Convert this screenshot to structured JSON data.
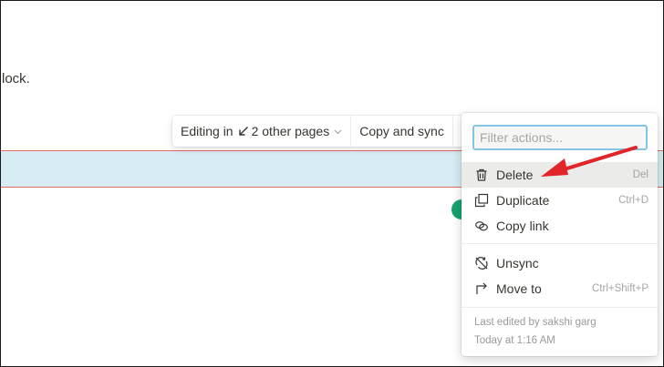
{
  "page": {
    "body_text": "lock."
  },
  "toolbar": {
    "editing_prefix": "Editing in",
    "editing_suffix": "2 other pages",
    "copy_and_sync": "Copy and sync"
  },
  "menu": {
    "filter_placeholder": "Filter actions...",
    "items": [
      {
        "label": "Delete",
        "shortcut": "Del",
        "icon": "trash-icon"
      },
      {
        "label": "Duplicate",
        "shortcut": "Ctrl+D",
        "icon": "duplicate-icon"
      },
      {
        "label": "Copy link",
        "shortcut": "",
        "icon": "link-icon"
      },
      {
        "label": "Unsync",
        "shortcut": "",
        "icon": "unsync-icon"
      },
      {
        "label": "Move to",
        "shortcut": "Ctrl+Shift+P",
        "icon": "move-to-icon"
      }
    ],
    "last_edited": "Last edited by sakshi garg",
    "edited_time": "Today at 1:16 AM"
  },
  "colors": {
    "synced_block_bg": "#d7ecf5",
    "synced_block_border": "#e76b5b",
    "filter_focus": "#84c4e8",
    "annotation_arrow": "#e0262a",
    "badge_green": "#15a36d"
  }
}
